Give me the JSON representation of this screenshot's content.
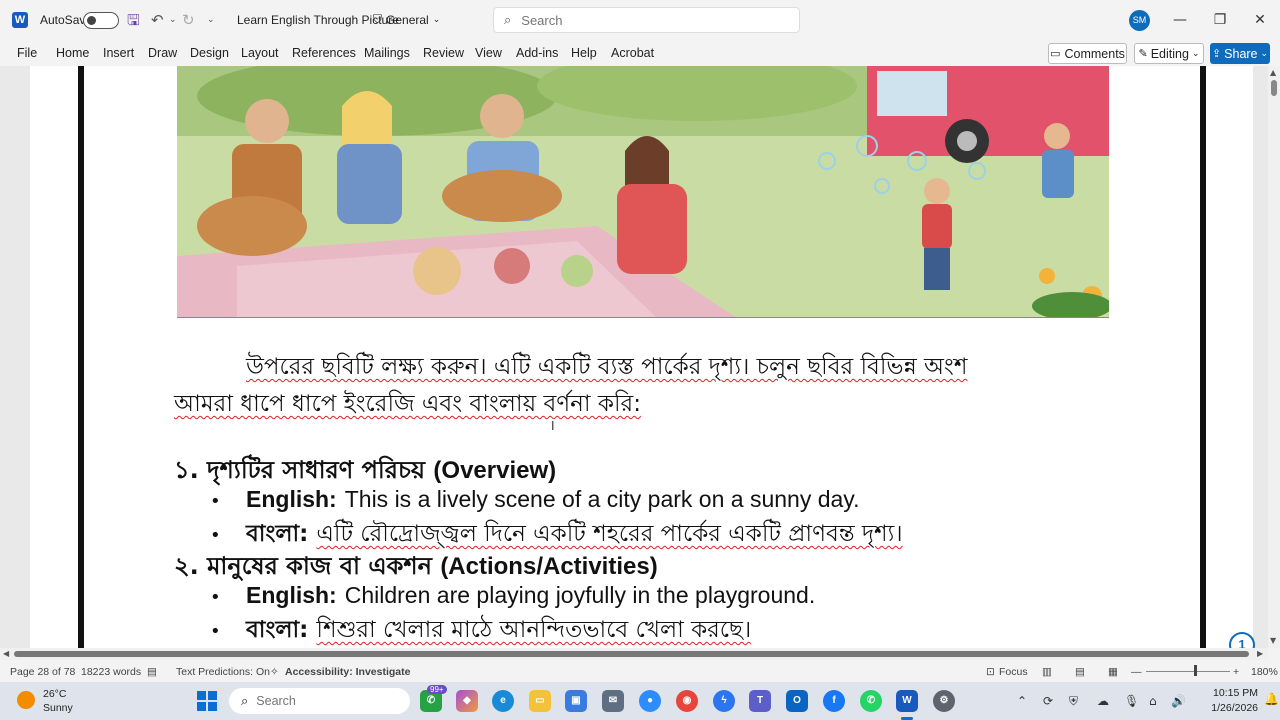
{
  "titlebar": {
    "app_logo": "W",
    "autosave_label": "AutoSave",
    "doc_title": "Learn English Through Picture",
    "sensitivity": "General",
    "search_placeholder": "Search",
    "avatar_initials": "SM",
    "minimize": "—",
    "maximize": "❐",
    "close": "✕"
  },
  "ribbon": {
    "tabs": [
      "File",
      "Home",
      "Insert",
      "Draw",
      "Design",
      "Layout",
      "References",
      "Mailings",
      "Review",
      "View",
      "Add-ins",
      "Help",
      "Acrobat"
    ],
    "comments": "Comments",
    "editing": "Editing",
    "share": "Share"
  },
  "document": {
    "paragraph_line1": "উপরের ছবিটি লক্ষ্য করুন। এটি একটি ব্যস্ত পার্কের দৃশ্য। চলুন ছবির বিভিন্ন অংশ",
    "paragraph_line2": "আমরা ধাপে ধাপে ইংরেজি এবং বাংলায় বর্ণনা করি:",
    "sections": [
      {
        "heading_bn": "১. দৃশ্যটির সাধারণ পরিচয়",
        "heading_en": "(Overview)",
        "english_key": "English:",
        "english_text": "This is a lively scene of a city park on a sunny day.",
        "bangla_key": "বাংলা:",
        "bangla_text": "এটি রৌদ্রোজ্জ্বল দিনে একটি শহরের পার্কের একটি প্রাণবন্ত দৃশ্য।"
      },
      {
        "heading_bn": "২. মানুষের কাজ বা একশন",
        "heading_en": "(Actions/Activities)",
        "english_key": "English:",
        "english_text": "Children are playing joyfully in the playground.",
        "bangla_key": "বাংলা:",
        "bangla_text": "শিশুরা খেলার মাঠে আনন্দিতভাবে খেলা করছে।"
      }
    ],
    "help_badge": "1"
  },
  "statusbar": {
    "page": "Page 28 of 78",
    "words": "18223 words",
    "text_predictions": "Text Predictions: On",
    "accessibility": "Accessibility: Investigate",
    "focus": "Focus",
    "zoom": "180%"
  },
  "taskbar": {
    "temperature": "26°C",
    "weather": "Sunny",
    "search_placeholder": "Search",
    "badge": "99+",
    "time": "10:15 PM",
    "date": "1/26/2026"
  },
  "colors": {
    "accent": "#0f6cbd",
    "word_blue": "#185abd",
    "taskbar": "#dfe4ec"
  }
}
